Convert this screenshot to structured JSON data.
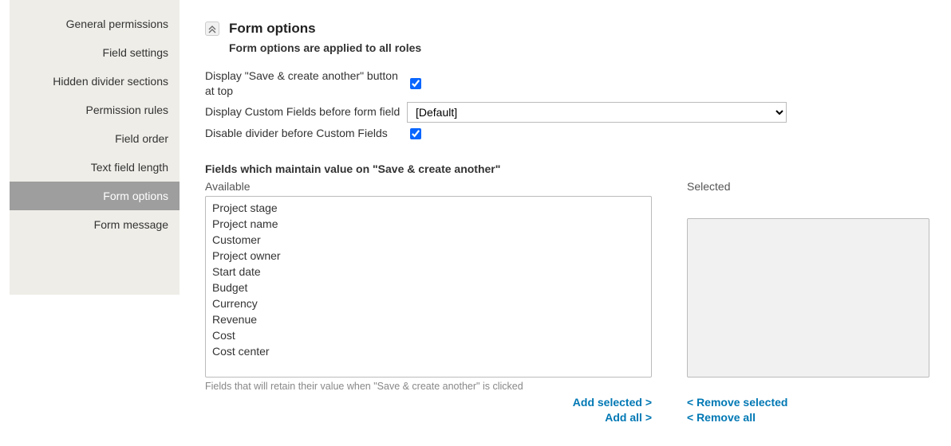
{
  "sidebar": {
    "items": [
      {
        "label": "General permissions"
      },
      {
        "label": "Field settings"
      },
      {
        "label": "Hidden divider sections"
      },
      {
        "label": "Permission rules"
      },
      {
        "label": "Field order"
      },
      {
        "label": "Text field length"
      },
      {
        "label": "Form options",
        "active": true
      },
      {
        "label": "Form message"
      }
    ]
  },
  "section": {
    "title": "Form options",
    "subtitle": "Form options are applied to all roles"
  },
  "options": {
    "save_create_label": "Display \"Save & create another\" button at top",
    "save_create_checked": true,
    "custom_before_label": "Display Custom Fields before form field",
    "custom_before_value": "[Default]",
    "disable_divider_label": "Disable divider before Custom Fields",
    "disable_divider_checked": true
  },
  "maintain": {
    "title": "Fields which maintain value on \"Save & create another\"",
    "available_label": "Available",
    "selected_label": "Selected",
    "available": [
      "Project stage",
      "Project name",
      "Customer",
      "Project owner",
      "Start date",
      "Budget",
      "Currency",
      "Revenue",
      "Cost",
      "Cost center"
    ],
    "selected": [],
    "helper": "Fields that will retain their value when \"Save & create another\" is clicked"
  },
  "actions": {
    "add_selected": "Add selected >",
    "add_all": "Add all >",
    "remove_selected": "< Remove selected",
    "remove_all": "< Remove all"
  }
}
